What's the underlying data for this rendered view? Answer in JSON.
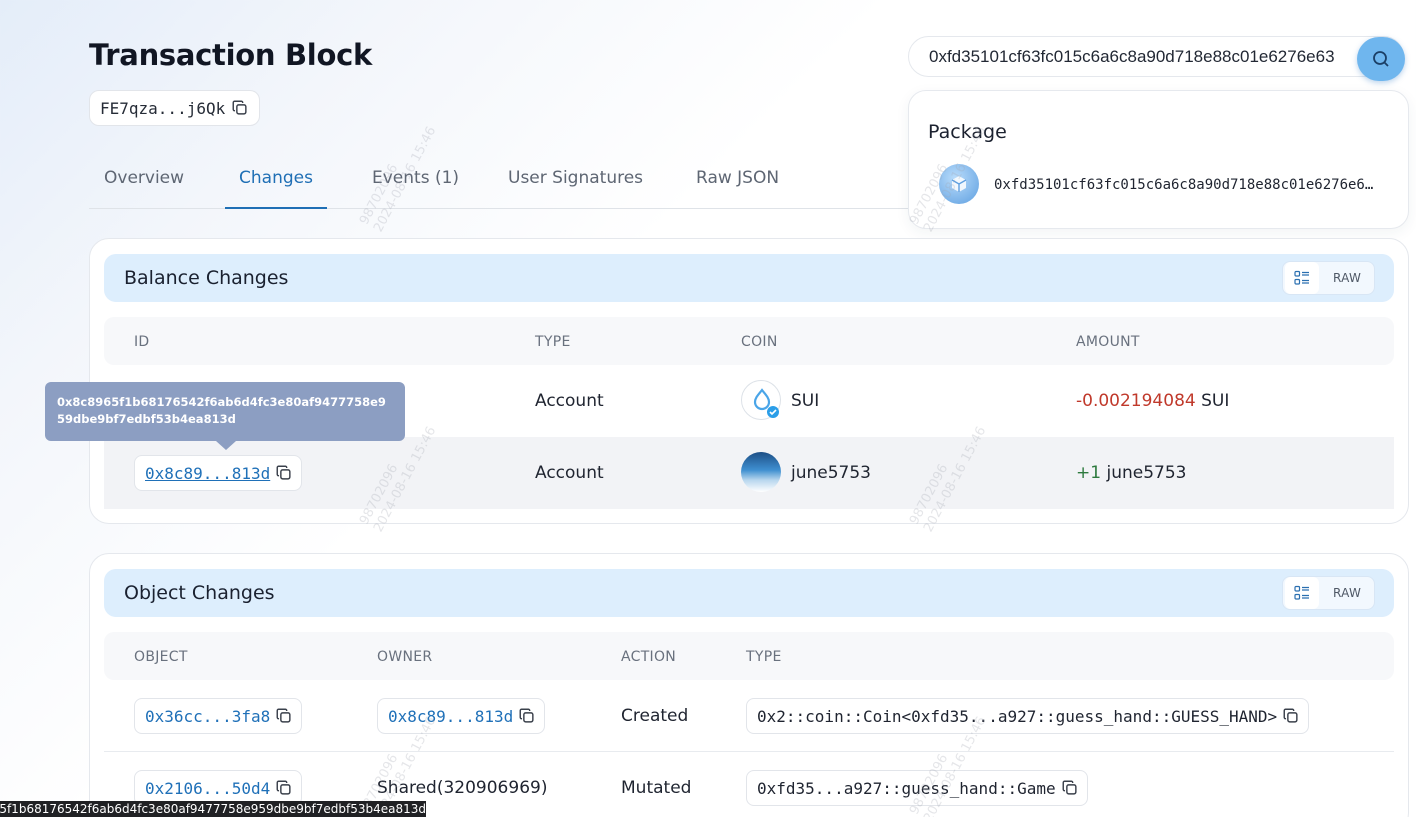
{
  "header": {
    "title": "Transaction Block",
    "digest": "FE7qza...j6Qk"
  },
  "tabs": [
    {
      "label": "Overview"
    },
    {
      "label": "Changes",
      "active": true
    },
    {
      "label": "Events (1)"
    },
    {
      "label": "User Signatures"
    },
    {
      "label": "Raw JSON"
    }
  ],
  "search": {
    "value": "0xfd35101cf63fc015c6a6c8a90d718e88c01e6276e63",
    "dropdown": {
      "heading": "Package",
      "result": "0xfd35101cf63fc015c6a6c8a90d718e88c01e6276e63..."
    }
  },
  "balance_changes": {
    "title": "Balance Changes",
    "toggle_raw": "RAW",
    "columns": [
      "ID",
      "TYPE",
      "COIN",
      "AMOUNT"
    ],
    "rows": [
      {
        "id": "0x8c89...813d",
        "type": "Account",
        "coin": "SUI",
        "amount": "-0.002194084",
        "amount_unit": "SUI"
      },
      {
        "id": "0x8c89...813d",
        "type": "Account",
        "coin": "june5753",
        "amount": "+1",
        "amount_unit": "june5753"
      }
    ]
  },
  "object_changes": {
    "title": "Object Changes",
    "toggle_raw": "RAW",
    "columns": [
      "OBJECT",
      "OWNER",
      "ACTION",
      "TYPE"
    ],
    "rows": [
      {
        "object": "0x36cc...3fa8",
        "owner": "0x8c89...813d",
        "action": "Created",
        "type": "0x2::coin::Coin<0xfd35...a927::guess_hand::GUESS_HAND>"
      },
      {
        "object": "0x2106...50d4",
        "owner": "Shared(320906969)",
        "action": "Mutated",
        "type": "0xfd35...a927::guess_hand::Game"
      }
    ]
  },
  "tooltip": {
    "text": "0x8c8965f1b68176542f6ab6d4fc3e80af9477758e959dbe9bf7edbf53b4ea813d"
  },
  "status_bar": {
    "url": "0x8c8965f1b68176542f6ab6d4fc3e80af9477758e959dbe9bf7edbf53b4ea813d"
  },
  "watermark": {
    "line1": "98702096",
    "line2": "2024-08-16 15:46"
  },
  "colors": {
    "accent": "#1f6fb5",
    "card_header_bg": "#ddeefd",
    "negative": "#c0392b",
    "positive": "#2d7a3e",
    "tooltip_bg": "#8c9ec2"
  }
}
